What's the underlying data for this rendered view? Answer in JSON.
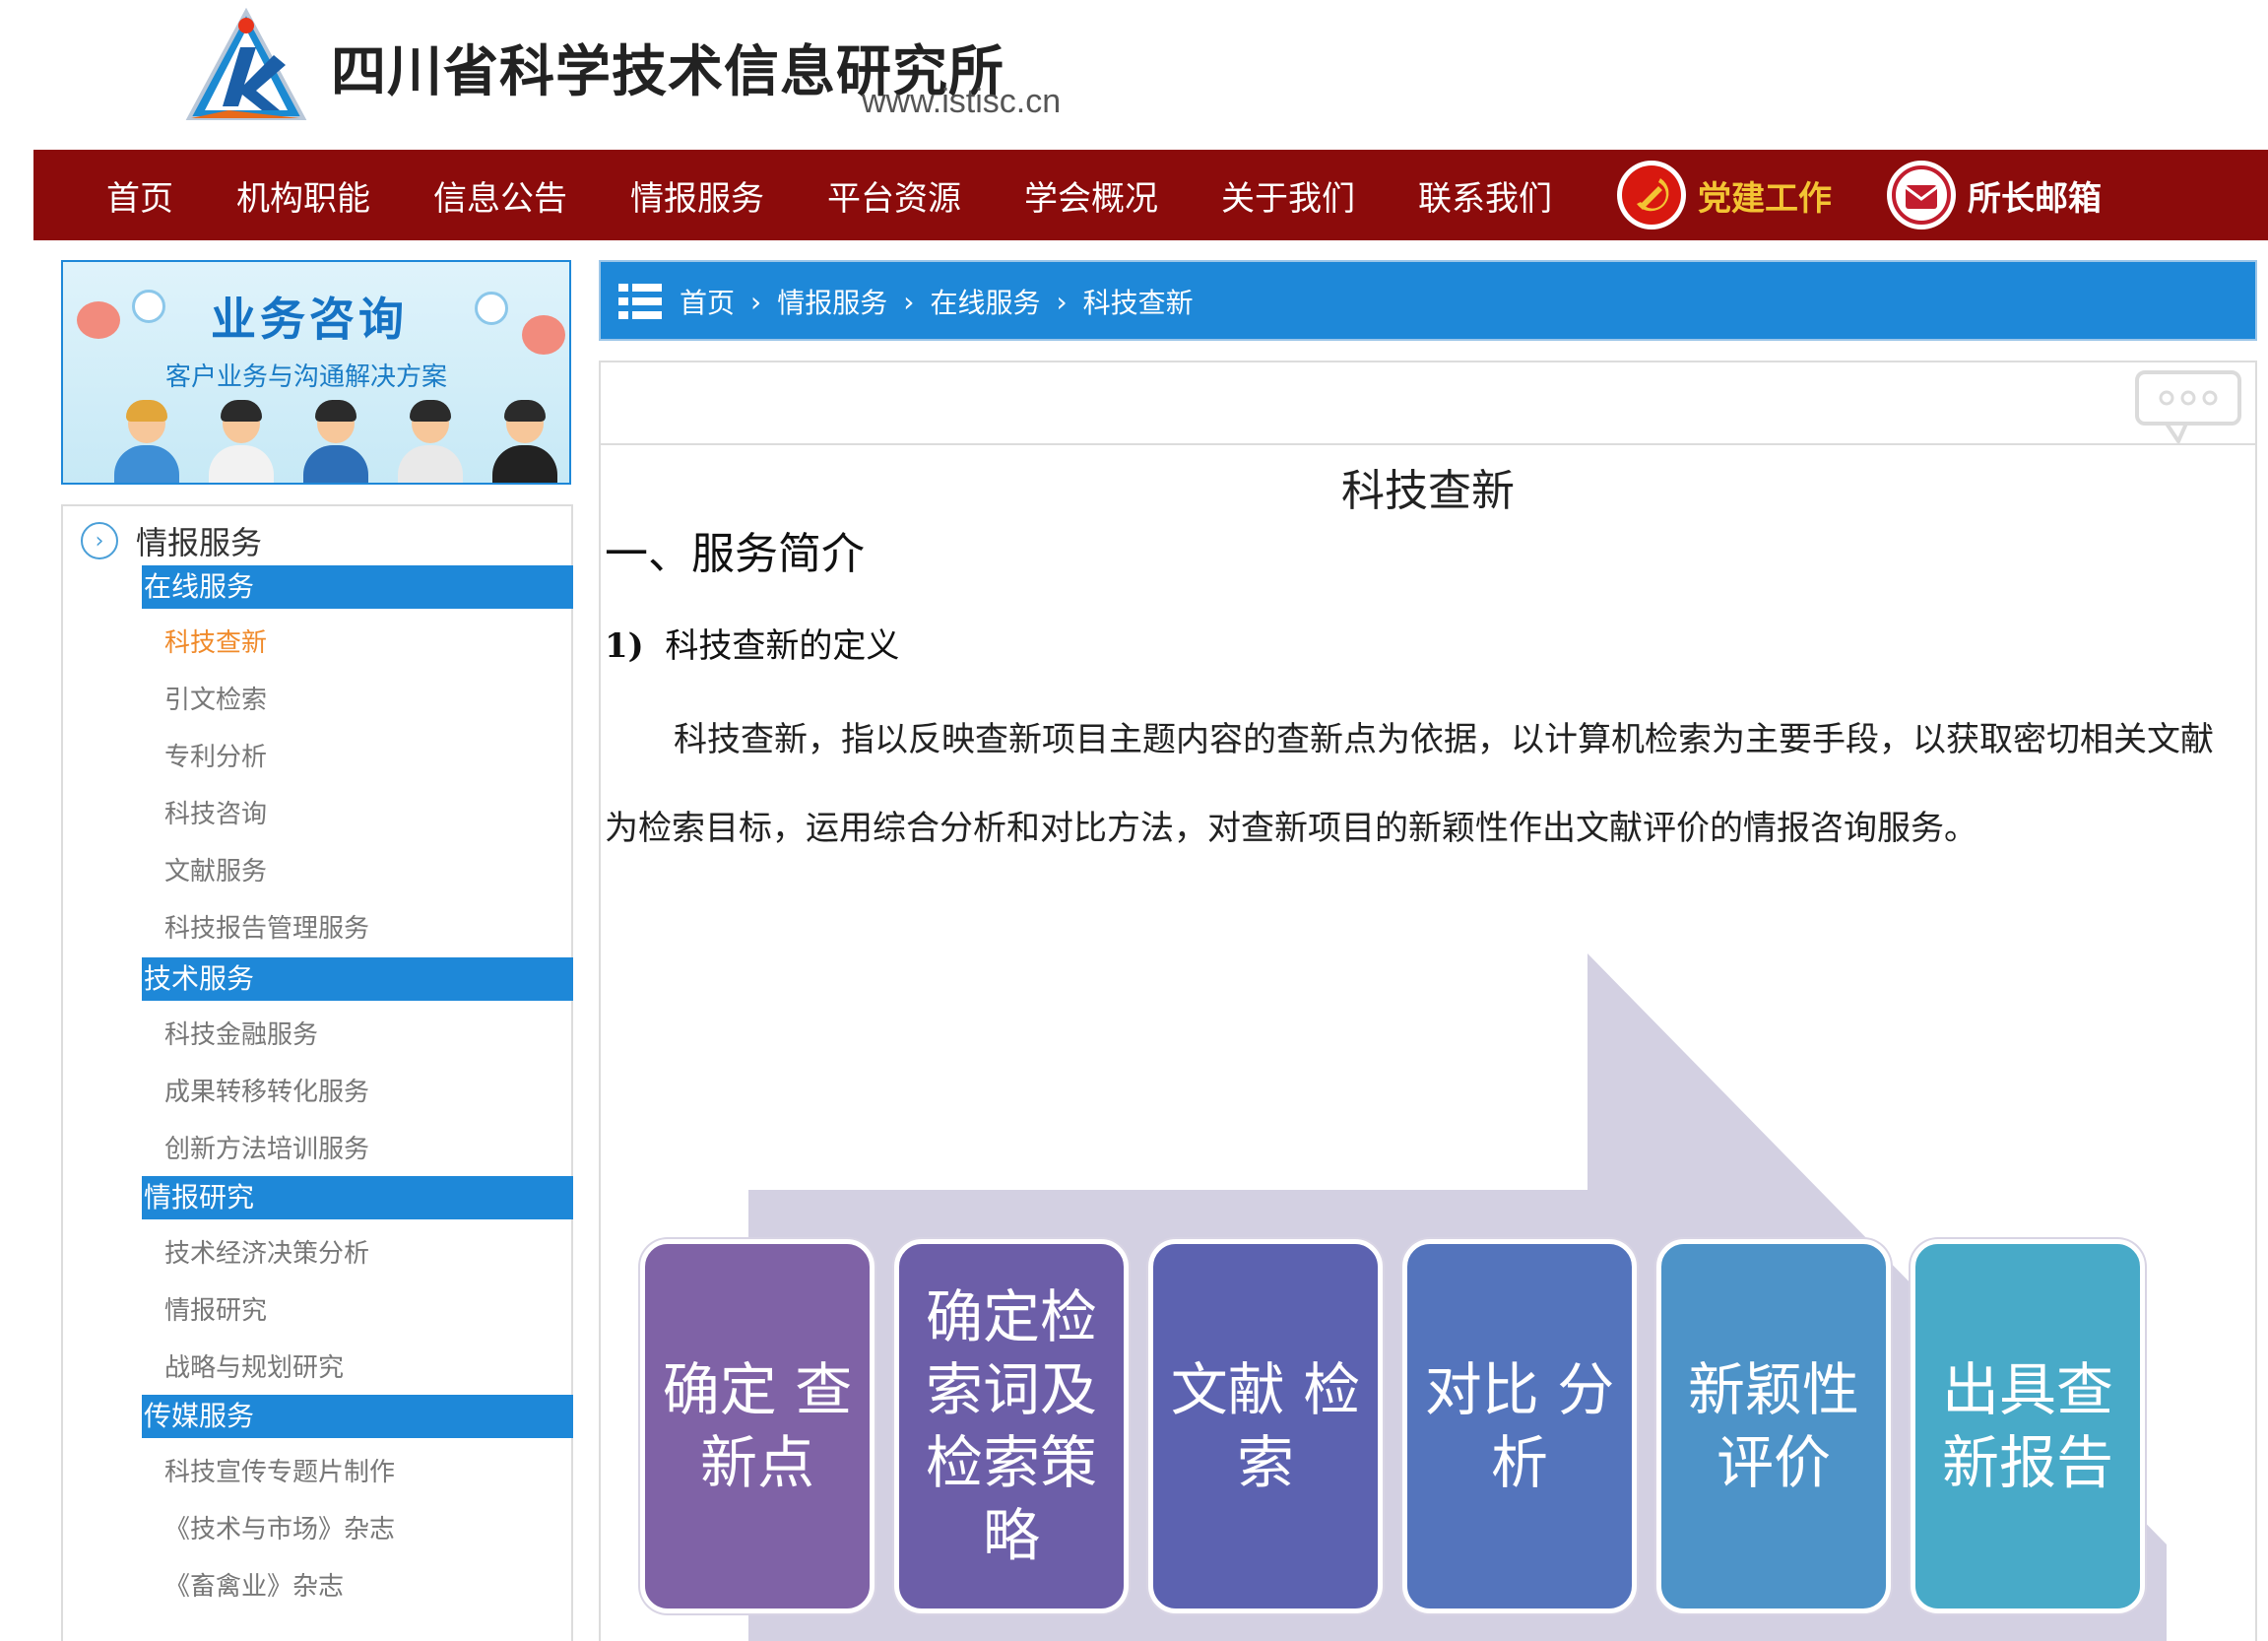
{
  "header": {
    "site_name": "四川省科学技术信息研究所",
    "site_url": "www.istisc.cn",
    "logo_icon": "istisc-logo-icon"
  },
  "nav": {
    "items": [
      "首页",
      "机构职能",
      "信息公告",
      "情报服务",
      "平台资源",
      "学会概况",
      "关于我们",
      "联系我们"
    ],
    "party": {
      "label": "党建工作",
      "icon": "hammer-sickle-icon"
    },
    "mailbox": {
      "label": "所长邮箱",
      "icon": "mailbox-icon"
    }
  },
  "banner": {
    "title": "业务咨询",
    "subtitle": "客户业务与沟通解决方案"
  },
  "sidebar": {
    "heading": "情报服务",
    "categories": [
      {
        "label": "在线服务",
        "links": [
          "科技查新",
          "引文检索",
          "专利分析",
          "科技咨询",
          "文献服务",
          "科技报告管理服务"
        ]
      },
      {
        "label": "技术服务",
        "links": [
          "科技金融服务",
          "成果转移转化服务",
          "创新方法培训服务"
        ]
      },
      {
        "label": "情报研究",
        "links": [
          "技术经济决策分析",
          "情报研究",
          "战略与规划研究"
        ]
      },
      {
        "label": "传媒服务",
        "links": [
          "科技宣传专题片制作",
          "《技术与市场》杂志",
          "《畜禽业》杂志"
        ]
      }
    ],
    "active_link": "科技查新"
  },
  "breadcrumb": {
    "icon": "list-icon",
    "items": [
      "首页",
      "情报服务",
      "在线服务",
      "科技查新"
    ]
  },
  "article": {
    "title": "科技查新",
    "section1": "一、服务简介",
    "sub1_num": "1)",
    "sub1_text": "科技查新的定义",
    "paragraph": "科技查新，指以反映查新项目主题内容的查新点为依据，以计算机检索为主要手段，以获取密切相关文献为检索目标，运用综合分析和对比方法，对查新项目的新颖性作出文献评价的情报咨询服务。"
  },
  "process": {
    "steps": [
      {
        "text": "确定 查新点",
        "color": "#7f62a6"
      },
      {
        "text": "确定检索词及检索策略",
        "color": "#6c5ea8"
      },
      {
        "text": "文献 检索",
        "color": "#5c62b0"
      },
      {
        "text": "对比 分析",
        "color": "#5474bc"
      },
      {
        "text": "新颖性 评价",
        "color": "#4d93c8"
      },
      {
        "text": "出具查 新报告",
        "color": "#48aac8"
      }
    ],
    "arrow_color": "#d3d0e2"
  }
}
